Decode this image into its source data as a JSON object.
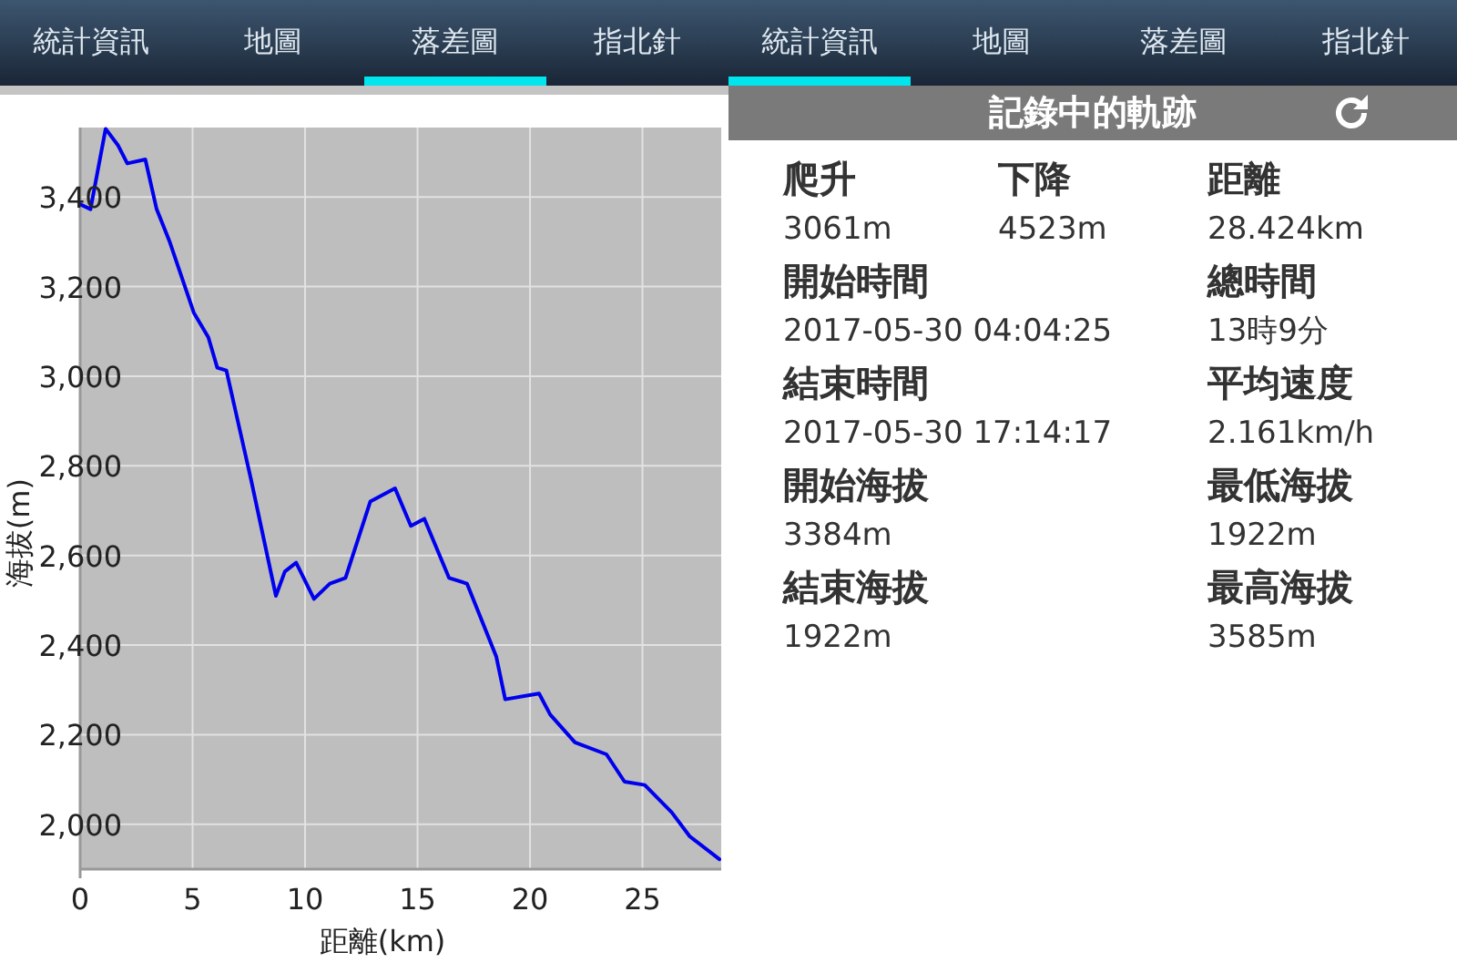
{
  "left_panel": {
    "tabs": [
      {
        "label": "統計資訊",
        "selected": false
      },
      {
        "label": "地圖",
        "selected": false
      },
      {
        "label": "落差圖",
        "selected": true
      },
      {
        "label": "指北針",
        "selected": false
      }
    ],
    "chart_data": {
      "type": "line",
      "xlabel": "距離(km)",
      "ylabel": "海拔(m)",
      "xlim": [
        0,
        28.5
      ],
      "ylim": [
        1900,
        3555
      ],
      "xticks": [
        {
          "value": 0,
          "label": "0"
        },
        {
          "value": 5,
          "label": "5"
        },
        {
          "value": 10,
          "label": "10"
        },
        {
          "value": 15,
          "label": "15"
        },
        {
          "value": 20,
          "label": "20"
        },
        {
          "value": 25,
          "label": "25"
        }
      ],
      "yticks": [
        {
          "value": 2000,
          "label": "2,000"
        },
        {
          "value": 2200,
          "label": "2,200"
        },
        {
          "value": 2400,
          "label": "2,400"
        },
        {
          "value": 2600,
          "label": "2,600"
        },
        {
          "value": 2800,
          "label": "2,800"
        },
        {
          "value": 3000,
          "label": "3,000"
        },
        {
          "value": 3200,
          "label": "3,200"
        },
        {
          "value": 3400,
          "label": "3,400"
        }
      ],
      "x": [
        0,
        0.46,
        1.13,
        1.68,
        2.1,
        2.9,
        3.4,
        3.97,
        5.05,
        5.7,
        6.1,
        6.5,
        7.6,
        8.7,
        9.1,
        9.6,
        10.4,
        11.1,
        11.8,
        12.9,
        14.0,
        14.7,
        15.3,
        16.4,
        17.2,
        18.5,
        18.9,
        20.4,
        20.9,
        22.0,
        23.4,
        24.2,
        25.1,
        26.3,
        27.1,
        28.42
      ],
      "grid": true,
      "series": [
        {
          "color": "#0000ee",
          "values": [
            3384,
            3373,
            3552,
            3516,
            3475,
            3484,
            3373,
            3302,
            3142,
            3087,
            3019,
            3013,
            2768,
            2510,
            2564,
            2584,
            2503,
            2537,
            2550,
            2720,
            2750,
            2666,
            2682,
            2550,
            2537,
            2374,
            2279,
            2292,
            2245,
            2183,
            2156,
            2095,
            2088,
            2027,
            1973,
            1922
          ]
        }
      ]
    }
  },
  "right_panel": {
    "tabs": [
      {
        "label": "統計資訊",
        "selected": true
      },
      {
        "label": "地圖",
        "selected": false
      },
      {
        "label": "落差圖",
        "selected": false
      },
      {
        "label": "指北針",
        "selected": false
      }
    ],
    "header": {
      "title": "記錄中的軌跡"
    },
    "stats": [
      [
        {
          "label": "爬升",
          "value": "3061m"
        },
        {
          "label": "下降",
          "value": "4523m"
        },
        {
          "label": "距離",
          "value": "28.424km"
        }
      ],
      [
        {
          "label": "開始時間",
          "value": "2017-05-30 04:04:25"
        },
        {
          "label": "總時間",
          "value": "13時9分"
        }
      ],
      [
        {
          "label": "結束時間",
          "value": "2017-05-30 17:14:17"
        },
        {
          "label": "平均速度",
          "value": "2.161km/h"
        }
      ],
      [
        {
          "label": "開始海拔",
          "value": "3384m"
        },
        {
          "label": "最低海拔",
          "value": "1922m"
        }
      ],
      [
        {
          "label": "結束海拔",
          "value": "1922m"
        },
        {
          "label": "最高海拔",
          "value": "3585m"
        }
      ]
    ]
  }
}
